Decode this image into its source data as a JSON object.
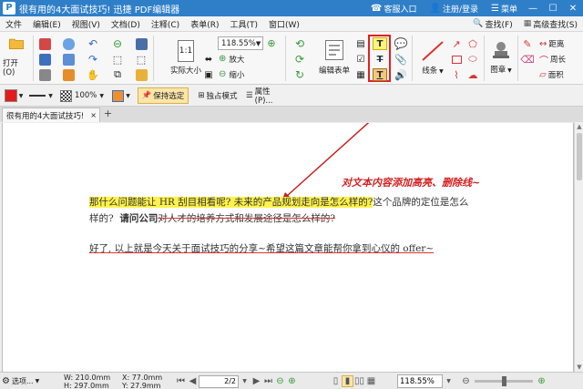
{
  "titlebar": {
    "logo": "P",
    "title": "很有用的4大面试技巧! 迅捷 PDF编辑器",
    "service": "客服入口",
    "login": "注册/登录",
    "menu": "菜单"
  },
  "menubar": {
    "items": [
      "文件",
      "编辑(E)",
      "视图(V)",
      "文档(D)",
      "注释(C)",
      "表单(R)",
      "工具(T)",
      "窗口(W)"
    ],
    "find": "查找(F)",
    "advanced_find": "高级查找(S)"
  },
  "ribbon": {
    "open_label": "打开(O)",
    "actual_size_label": "实际大小",
    "zoom_value": "118.55%",
    "zoom_in_label": "放大",
    "zoom_out_label": "缩小",
    "edit_form_label": "编辑表单",
    "line_label": "线条",
    "stamp_label": "图章",
    "distance_label": "距离",
    "perimeter_label": "周长",
    "area_label": "面积"
  },
  "toolbar2": {
    "fill_color": "#e31b1b",
    "opacity": "100%",
    "keep_selected": "保持选定",
    "exclusive_mode": "独占模式",
    "properties": "属性(P)..."
  },
  "tabs": [
    {
      "label": "很有用的4大面试技巧!",
      "close": "×"
    }
  ],
  "document": {
    "annotation": "对文本内容添加高亮、删除线~",
    "p1_highlight": "那什么问题能让 HR 刮目相看呢? 未来的产品规划走向是怎么样的?",
    "p1_rest": "这个品牌的定位是怎么",
    "p1_line2_a": "样的?",
    "p1_line2_bold": "请问公司",
    "p1_line2_strike": "对人才的培养方式和发展途径是怎么样的?",
    "p2": "好了, 以上就是今天关于面试技巧的分享~希望这篇文章能帮你拿到心仪的 offer~"
  },
  "statusbar": {
    "options": "选项...",
    "width": "W: 210.0mm",
    "height": "H: 297.0mm",
    "x": "X:  77.0mm",
    "y": "Y:  27.9mm",
    "page": "2/2",
    "zoom": "118.55%"
  },
  "colors": {
    "titlebar": "#2f7fc8",
    "highlight": "#fff24a",
    "annotation": "#d42020",
    "callout_box": "#e02020"
  }
}
